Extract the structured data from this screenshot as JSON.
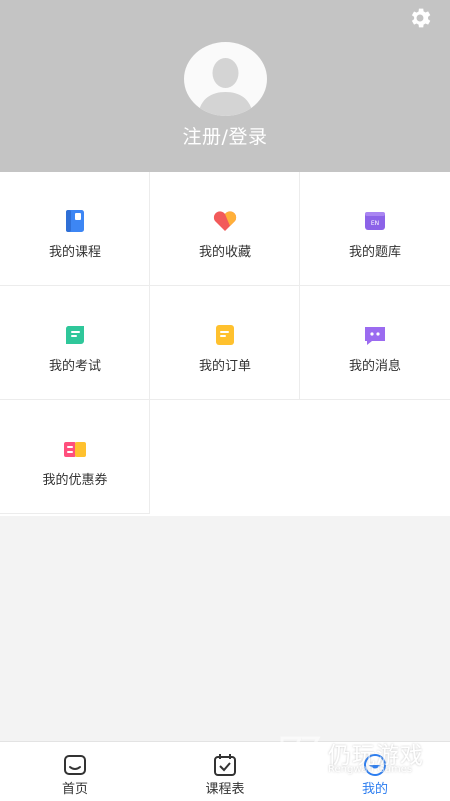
{
  "header": {
    "login_label": "注册/登录",
    "settings_icon": "gear-icon",
    "avatar_icon": "default-avatar"
  },
  "menu": [
    {
      "label": "我的课程",
      "icon": "course-book-icon",
      "color": "#3d86f4"
    },
    {
      "label": "我的收藏",
      "icon": "favorite-heart-icon",
      "color": "#f25a5a"
    },
    {
      "label": "我的题库",
      "icon": "question-bank-icon",
      "color": "#8c63e8"
    },
    {
      "label": "我的考试",
      "icon": "exam-scroll-icon",
      "color": "#2fc79a"
    },
    {
      "label": "我的订单",
      "icon": "order-note-icon",
      "color": "#ffc12e"
    },
    {
      "label": "我的消息",
      "icon": "message-bubble-icon",
      "color": "#9b6bf0"
    },
    {
      "label": "我的优惠券",
      "icon": "coupon-icon",
      "color": "#ff4f7d"
    }
  ],
  "tabbar": {
    "tabs": [
      {
        "label": "首页",
        "icon": "home-icon"
      },
      {
        "label": "课程表",
        "icon": "calendar-icon"
      },
      {
        "label": "我的",
        "icon": "profile-icon",
        "active": true
      }
    ],
    "active_color": "#2d7ef0"
  },
  "watermark": {
    "title": "仍玩游戏",
    "subtitle": "Rengwan Games"
  }
}
